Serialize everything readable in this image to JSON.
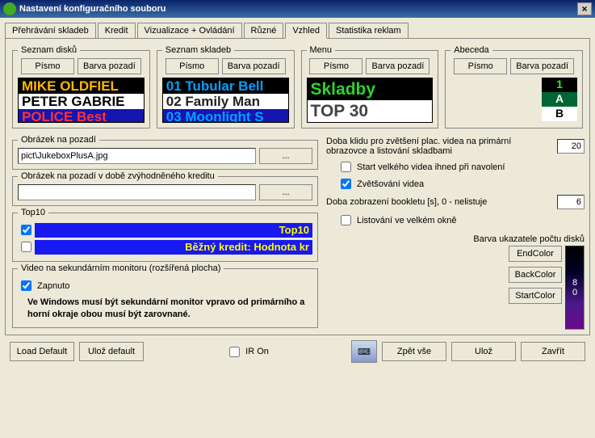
{
  "window": {
    "title": "Nastavení konfiguračního souboru"
  },
  "tabs": {
    "t0": "Přehrávání skladeb",
    "t1": "Kredit",
    "t2": "Vizualizace + Ovládání",
    "t3": "Různé",
    "t4": "Vzhled",
    "t5": "Statistika reklam"
  },
  "groups": {
    "disks": {
      "legend": "Seznam disků",
      "font": "Písmo",
      "bg": "Barva pozadí",
      "l1": "MIKE OLDFIEL",
      "l2": "PETER GABRIE",
      "l3": "POLICE   Best"
    },
    "tracks": {
      "legend": "Seznam skladeb",
      "font": "Písmo",
      "bg": "Barva pozadí",
      "l1": "01 Tubular Bell",
      "l2": "02 Family Man",
      "l3": "03 Moonlight S"
    },
    "menu": {
      "legend": "Menu",
      "font": "Písmo",
      "bg": "Barva pozadí",
      "l1": "Skladby",
      "l2": "TOP 30"
    },
    "abc": {
      "legend": "Abeceda",
      "font": "Písmo",
      "bg": "Barva pozadí",
      "l1": "1",
      "l2": "A",
      "l3": "B"
    }
  },
  "bgimage": {
    "legend": "Obrázek na pozadí",
    "path": "pict\\JukeboxPlusA.jpg",
    "browse": "..."
  },
  "bgimage_credit": {
    "legend": "Obrázek na pozadí v době zvýhodněného kreditu",
    "path": "",
    "browse": "..."
  },
  "top10": {
    "legend": "Top10",
    "bar1": "Top10",
    "bar2": "Běžný kredit: Hodnota kr"
  },
  "video": {
    "legend": "Video na sekundárním monitoru (rozšířená plocha)",
    "enabled": "Zapnuto",
    "note": "Ve Windows musí být sekundární monitor vpravo od primárního a horní okraje obou musí být zarovnané."
  },
  "right": {
    "idle_label": "Doba klidu pro zvětšení plac. videa na primární obrazovce a listování skladbami",
    "idle_value": "20",
    "chk_bigvideo_immediate": "Start velkého videa ihned při navolení",
    "chk_zoom_video": "Zvětšování videa",
    "booklet_label": "Doba zobrazení bookletu [s], 0 - nelistuje",
    "booklet_value": "6",
    "chk_bigwindow_browse": "Listování ve velkém okně"
  },
  "colors": {
    "title": "Barva ukazatele počtu disků",
    "end": "EndColor",
    "back": "BackColor",
    "start": "StartColor",
    "g1": "8",
    "g2": "0"
  },
  "bottom": {
    "load_default": "Load Default",
    "save_default": "Ulož default",
    "ir_on": "IR On",
    "undo_all": "Zpět vše",
    "save": "Ulož",
    "close": "Zavřít"
  }
}
